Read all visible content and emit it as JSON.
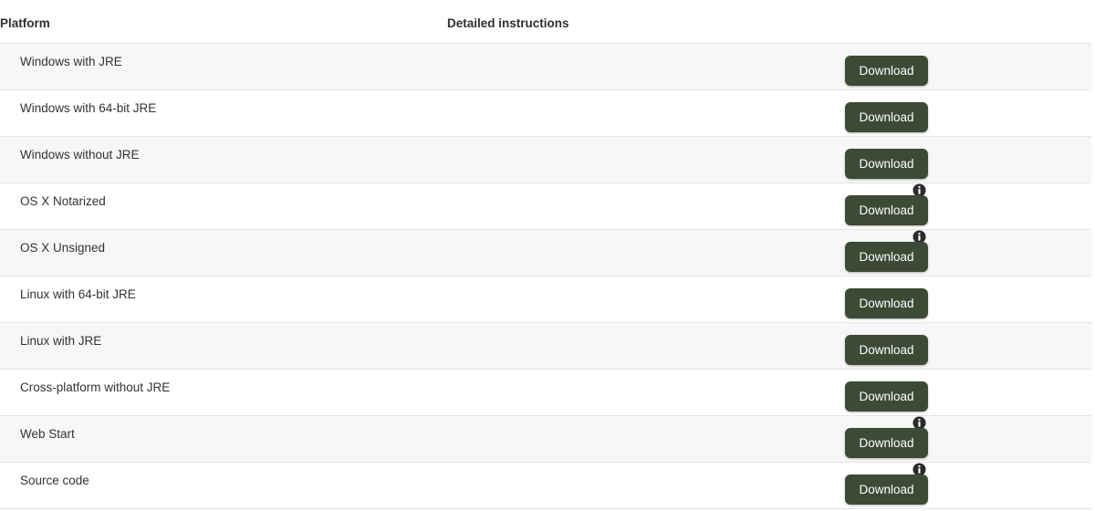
{
  "table": {
    "columns": {
      "platform": "Platform",
      "instructions": "Detailed instructions",
      "download": ""
    },
    "download_label": "Download",
    "info_icon_name": "info-icon",
    "colors": {
      "button_background": "#3c4a36",
      "button_text": "#ffffff",
      "row_stripe": "#f7f7f7",
      "row_plain": "#ffffff",
      "row_border": "#e4e4e4",
      "header_border": "#dddddd",
      "header_text": "#2f2f2f",
      "body_text": "#333333",
      "info_icon": "#2b2b2b"
    },
    "rows": [
      {
        "platform": "Windows with JRE",
        "has_info": false,
        "download": "Download"
      },
      {
        "platform": "Windows with 64-bit JRE",
        "has_info": false,
        "download": "Download"
      },
      {
        "platform": "Windows without JRE",
        "has_info": false,
        "download": "Download"
      },
      {
        "platform": "OS X Notarized",
        "has_info": true,
        "download": "Download"
      },
      {
        "platform": "OS X Unsigned",
        "has_info": true,
        "download": "Download"
      },
      {
        "platform": "Linux with 64-bit JRE",
        "has_info": false,
        "download": "Download"
      },
      {
        "platform": "Linux with JRE",
        "has_info": false,
        "download": "Download"
      },
      {
        "platform": "Cross-platform without JRE",
        "has_info": false,
        "download": "Download"
      },
      {
        "platform": "Web Start",
        "has_info": true,
        "download": "Download"
      },
      {
        "platform": "Source code",
        "has_info": true,
        "download": "Download"
      }
    ]
  }
}
